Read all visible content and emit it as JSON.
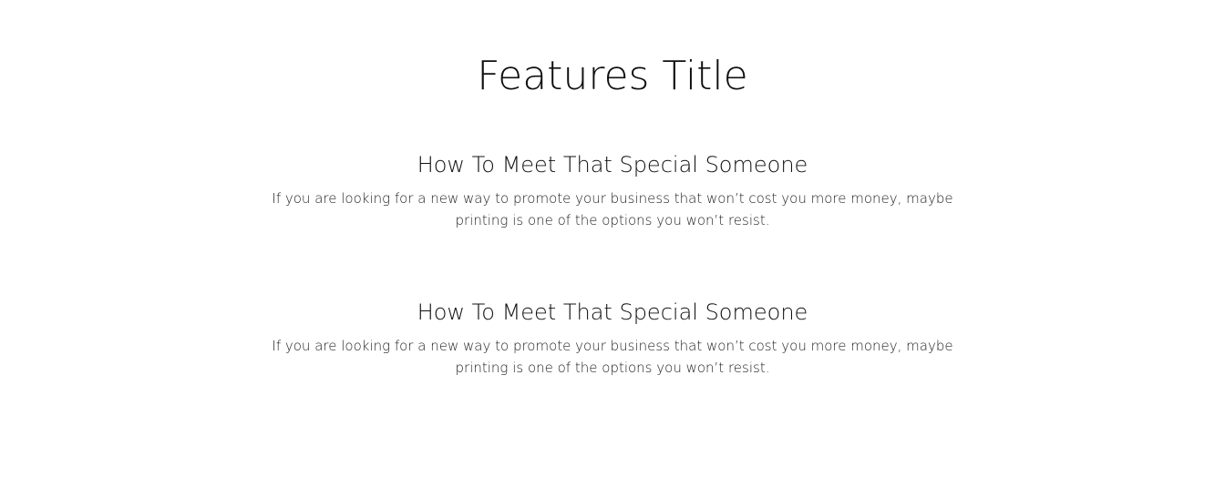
{
  "features": {
    "title": "Features Title",
    "items": [
      {
        "heading": "How To Meet That Special Someone",
        "text": "If you are looking for a new way to promote your business that won’t cost you more money, maybe printing is one of the options you won’t resist."
      },
      {
        "heading": "How To Meet That Special Someone",
        "text": "If you are looking for a new way to promote your business that won’t cost you more money, maybe printing is one of the options you won’t resist."
      }
    ]
  }
}
